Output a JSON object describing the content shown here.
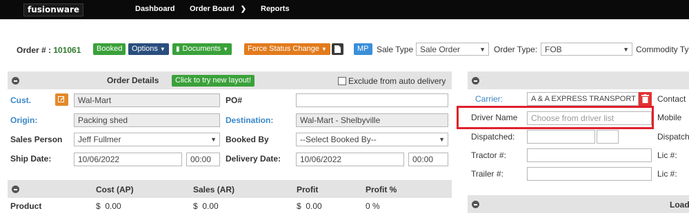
{
  "nav": {
    "logo_a": "fusion",
    "logo_b": "ware",
    "dashboard": "Dashboard",
    "order_board": "Order Board",
    "reports": "Reports"
  },
  "order": {
    "label": "Order # :",
    "number": "101061",
    "status": "Booked",
    "options": "Options",
    "documents": "Documents",
    "force_status": "Force Status Change",
    "mp": "MP",
    "sale_type_label": "Sale Type",
    "sale_type": "Sale Order",
    "order_type_label": "Order Type:",
    "order_type": "FOB",
    "commodity_label": "Commodity Ty"
  },
  "order_details": {
    "title": "Order Details",
    "new_layout": "Click to try new layout!",
    "exclude_label": "Exclude from auto delivery",
    "cust_label": "Cust.",
    "cust_value": "Wal-Mart",
    "po_label": "PO#",
    "po_value": "",
    "origin_label": "Origin:",
    "origin_value": "Packing shed",
    "destination_label": "Destination:",
    "destination_value": "Wal-Mart - Shelbyville",
    "sales_person_label": "Sales Person",
    "sales_person_value": "Jeff Fullmer",
    "booked_by_label": "Booked By",
    "booked_by_value": "--Select Booked By--",
    "ship_date_label": "Ship Date:",
    "ship_date": "10/06/2022",
    "ship_time": "00:00",
    "delivery_date_label": "Delivery Date:",
    "delivery_date": "10/06/2022",
    "delivery_time": "00:00"
  },
  "financials": {
    "headers": [
      "Cost (AP)",
      "Sales (AR)",
      "Profit",
      "Profit %"
    ],
    "row_label": "Product",
    "values": [
      "$  0.00",
      "$  0.00",
      "$  0.00",
      "0 %"
    ]
  },
  "carrier": {
    "carrier_label": "Carrier:",
    "carrier_value": "A & A EXPRESS TRANSPORT LLC",
    "contact_label": "Contact",
    "driver_label": "Driver Name",
    "driver_placeholder": "Choose from driver list",
    "mobile_label": "Mobile",
    "dispatched_label": "Dispatched:",
    "dispatch_label": "Dispatch",
    "tractor_label": "Tractor #:",
    "lic1_label": "Lic #:",
    "trailer_label": "Trailer #:",
    "lic2_label": "Lic #:",
    "load_label": "Load"
  },
  "colors": {
    "nav_bg": "#0a0a0a",
    "booked": "#3aa13a",
    "options": "#2a4e7d",
    "force_status": "#e27b1c",
    "mp": "#3b8fd9",
    "highlight": "#e01f2a",
    "link": "#3a87c8"
  }
}
